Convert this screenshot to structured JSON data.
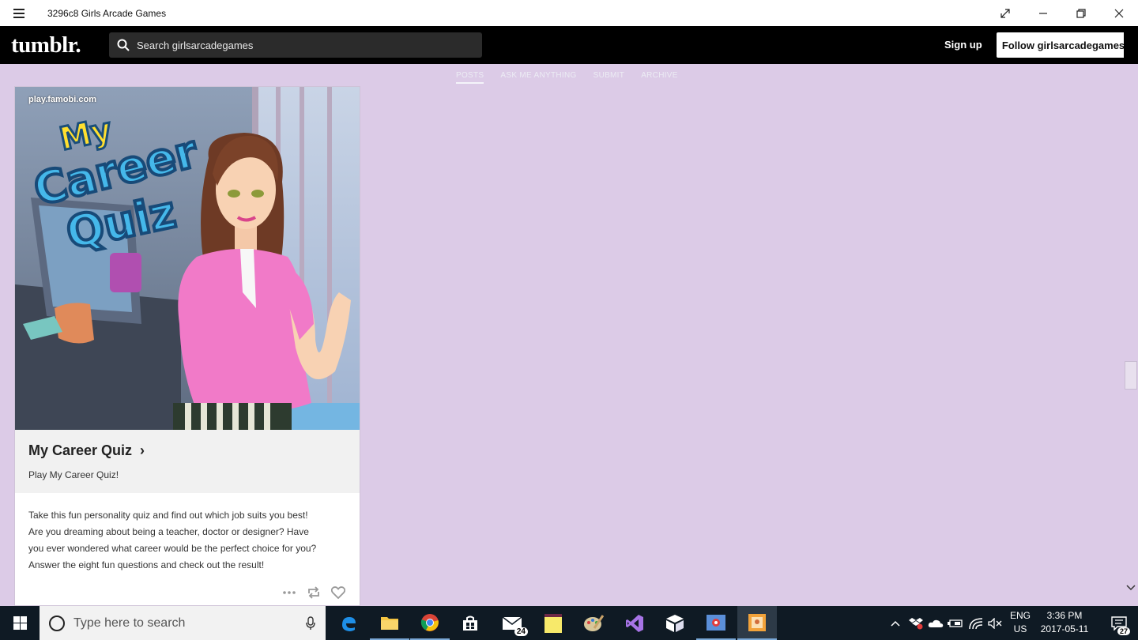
{
  "window": {
    "title": "3296c8 Girls Arcade Games",
    "controls": [
      "expand-icon",
      "minimize-icon",
      "restore-icon",
      "close-icon"
    ]
  },
  "header": {
    "logo": "tumblr.",
    "search_placeholder": "Search girlsarcadegames",
    "signup_label": "Sign up",
    "follow_label": "Follow girlsarcadegames"
  },
  "blog_nav": {
    "items": [
      {
        "label": "POSTS",
        "active": true
      },
      {
        "label": "ASK ME ANYTHING",
        "active": false
      },
      {
        "label": "SUBMIT",
        "active": false
      },
      {
        "label": "ARCHIVE",
        "active": false
      }
    ]
  },
  "post": {
    "source": "play.famobi.com",
    "image_title_words": [
      "My",
      "Career",
      "Quiz"
    ],
    "link_title": "My Career Quiz",
    "link_chevron": "›",
    "link_description": "Play My Career Quiz!",
    "body_lines": [
      "Take this fun personality quiz and find out which job suits you best!",
      "Are you dreaming about being a teacher, doctor or designer? Have",
      "you ever wondered what career would be the perfect choice for you?",
      "Answer the eight fun questions and check out the result!"
    ],
    "actions": [
      "more-icon",
      "reblog-icon",
      "like-icon"
    ]
  },
  "taskbar": {
    "search_placeholder": "Type here to search",
    "apps": [
      {
        "name": "edge",
        "running": false
      },
      {
        "name": "file-explorer",
        "running": true
      },
      {
        "name": "chrome",
        "running": true
      },
      {
        "name": "store",
        "running": false
      },
      {
        "name": "mail",
        "running": false,
        "badge": "24"
      },
      {
        "name": "sticky-notes",
        "running": false
      },
      {
        "name": "paint",
        "running": false
      },
      {
        "name": "visual-studio",
        "running": false
      },
      {
        "name": "package",
        "running": false
      },
      {
        "name": "app-blue",
        "running": true
      },
      {
        "name": "app-active",
        "running": true,
        "active": true
      }
    ],
    "language": [
      "ENG",
      "US"
    ],
    "time": "3:36 PM",
    "date": "2017-05-11",
    "notification_count": "27"
  },
  "colors": {
    "page_background": "#dccbe7",
    "header_background": "#000000",
    "taskbar_background": "#0f1a24"
  }
}
